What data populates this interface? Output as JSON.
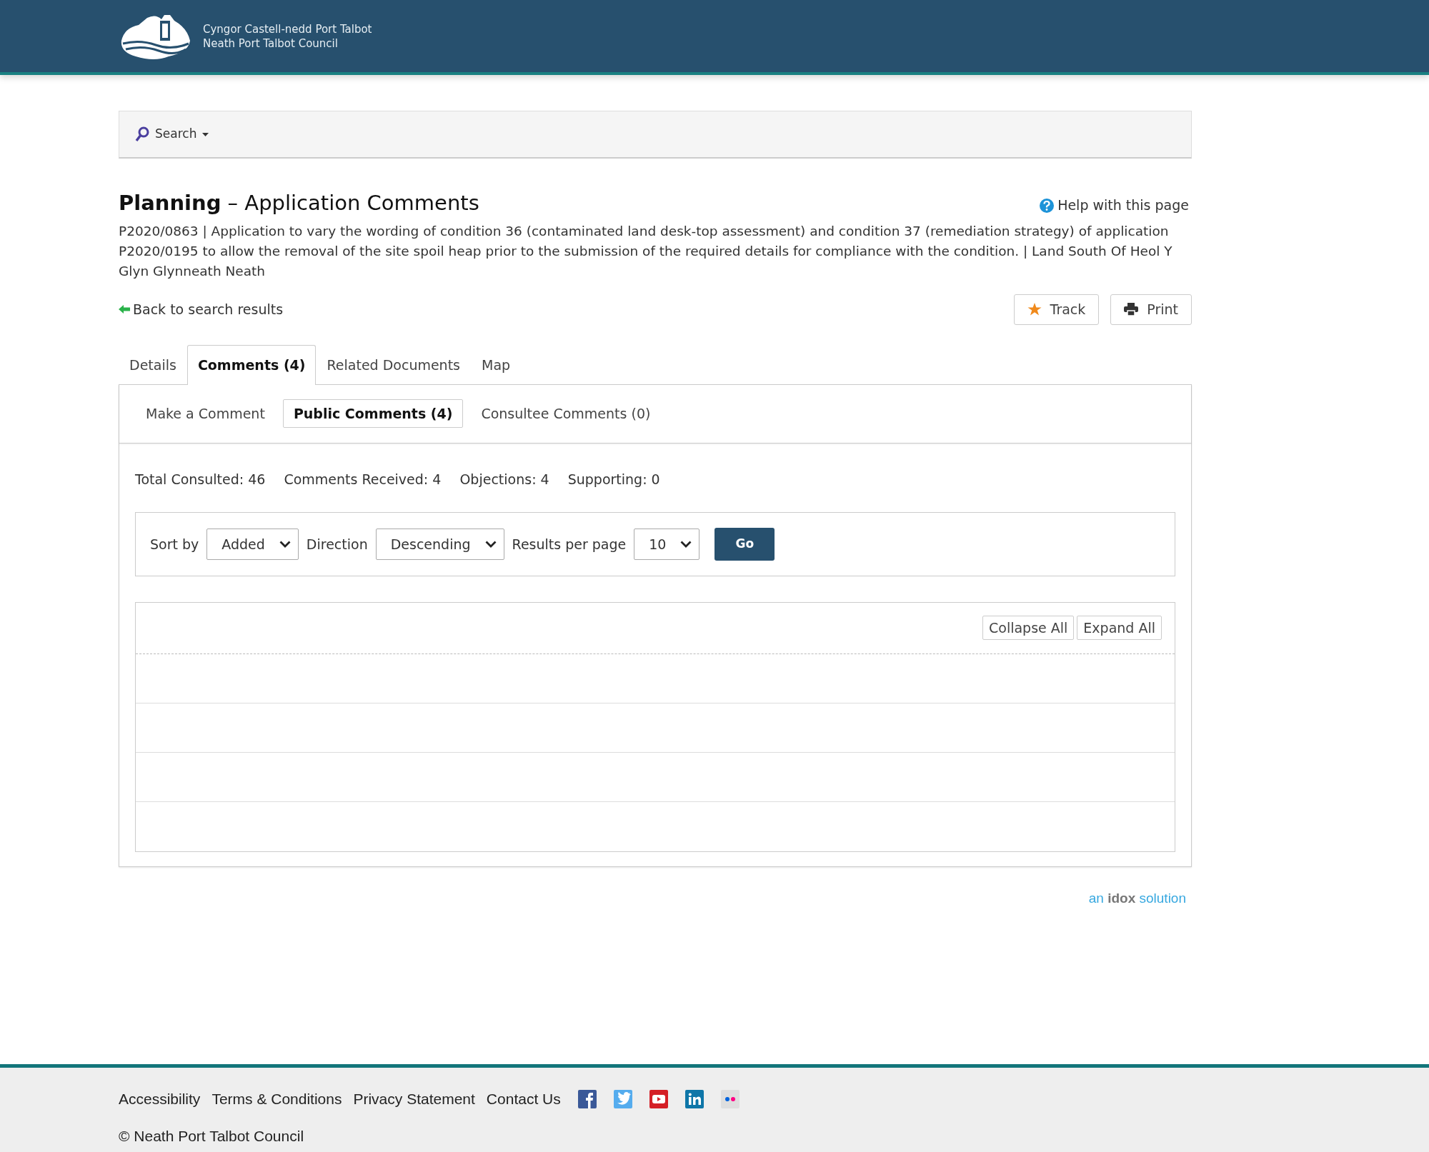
{
  "header": {
    "logo_lines": [
      "Cyngor Castell-nedd Port Talbot",
      "Neath Port Talbot Council"
    ]
  },
  "search_bar": {
    "label": "Search"
  },
  "page": {
    "title": "**Planning** – Application Comments",
    "help_link": "Help with this page",
    "description": "P2020/0863 | Application to vary the wording of condition 36 (contaminated land desk-top assessment) and condition 37 (remediation strategy) of application P2020/0195 to allow the removal of the site spoil heap prior to the submission of the required details for compliance with the condition. | Land South Of Heol Y Glyn Glynneath Neath",
    "back_link": "Back to search results",
    "actions": [
      {
        "kind": "track",
        "label": "Track"
      },
      {
        "kind": "print",
        "label": "Print"
      }
    ]
  },
  "tabs": [
    {
      "label": "Details",
      "selected": false
    },
    {
      "label": "Comments (4)",
      "selected": true
    },
    {
      "label": "Related Documents",
      "selected": false
    },
    {
      "label": "Map",
      "selected": false
    }
  ],
  "subtabs": [
    {
      "label": "Make a Comment",
      "selected": false
    },
    {
      "label": "Public Comments (4)",
      "selected": true
    },
    {
      "label": "Consultee Comments (0)",
      "selected": false
    }
  ],
  "stats": [
    "Total Consulted: 46",
    "Comments Received: 4",
    "Objections: 4",
    "Supporting: 0"
  ],
  "sort_form": {
    "fields": [
      {
        "label": "Sort by",
        "value": "Added"
      },
      {
        "label": "Direction",
        "value": "Descending"
      },
      {
        "label": "Results per page",
        "value": "10"
      }
    ],
    "submit": "Go"
  },
  "comments_toolbar": [
    "Collapse All",
    "Expand All"
  ],
  "idox": [
    "an",
    "idox",
    "solution"
  ],
  "footer": {
    "links": [
      "Accessibility",
      "Terms & Conditions",
      "Privacy Statement",
      "Contact Us"
    ],
    "social": [
      {
        "kind": "facebook"
      },
      {
        "kind": "twitter"
      },
      {
        "kind": "youtube"
      },
      {
        "kind": "linkedin"
      },
      {
        "kind": "flickr"
      }
    ],
    "copyright": "© Neath Port Talbot Council"
  }
}
